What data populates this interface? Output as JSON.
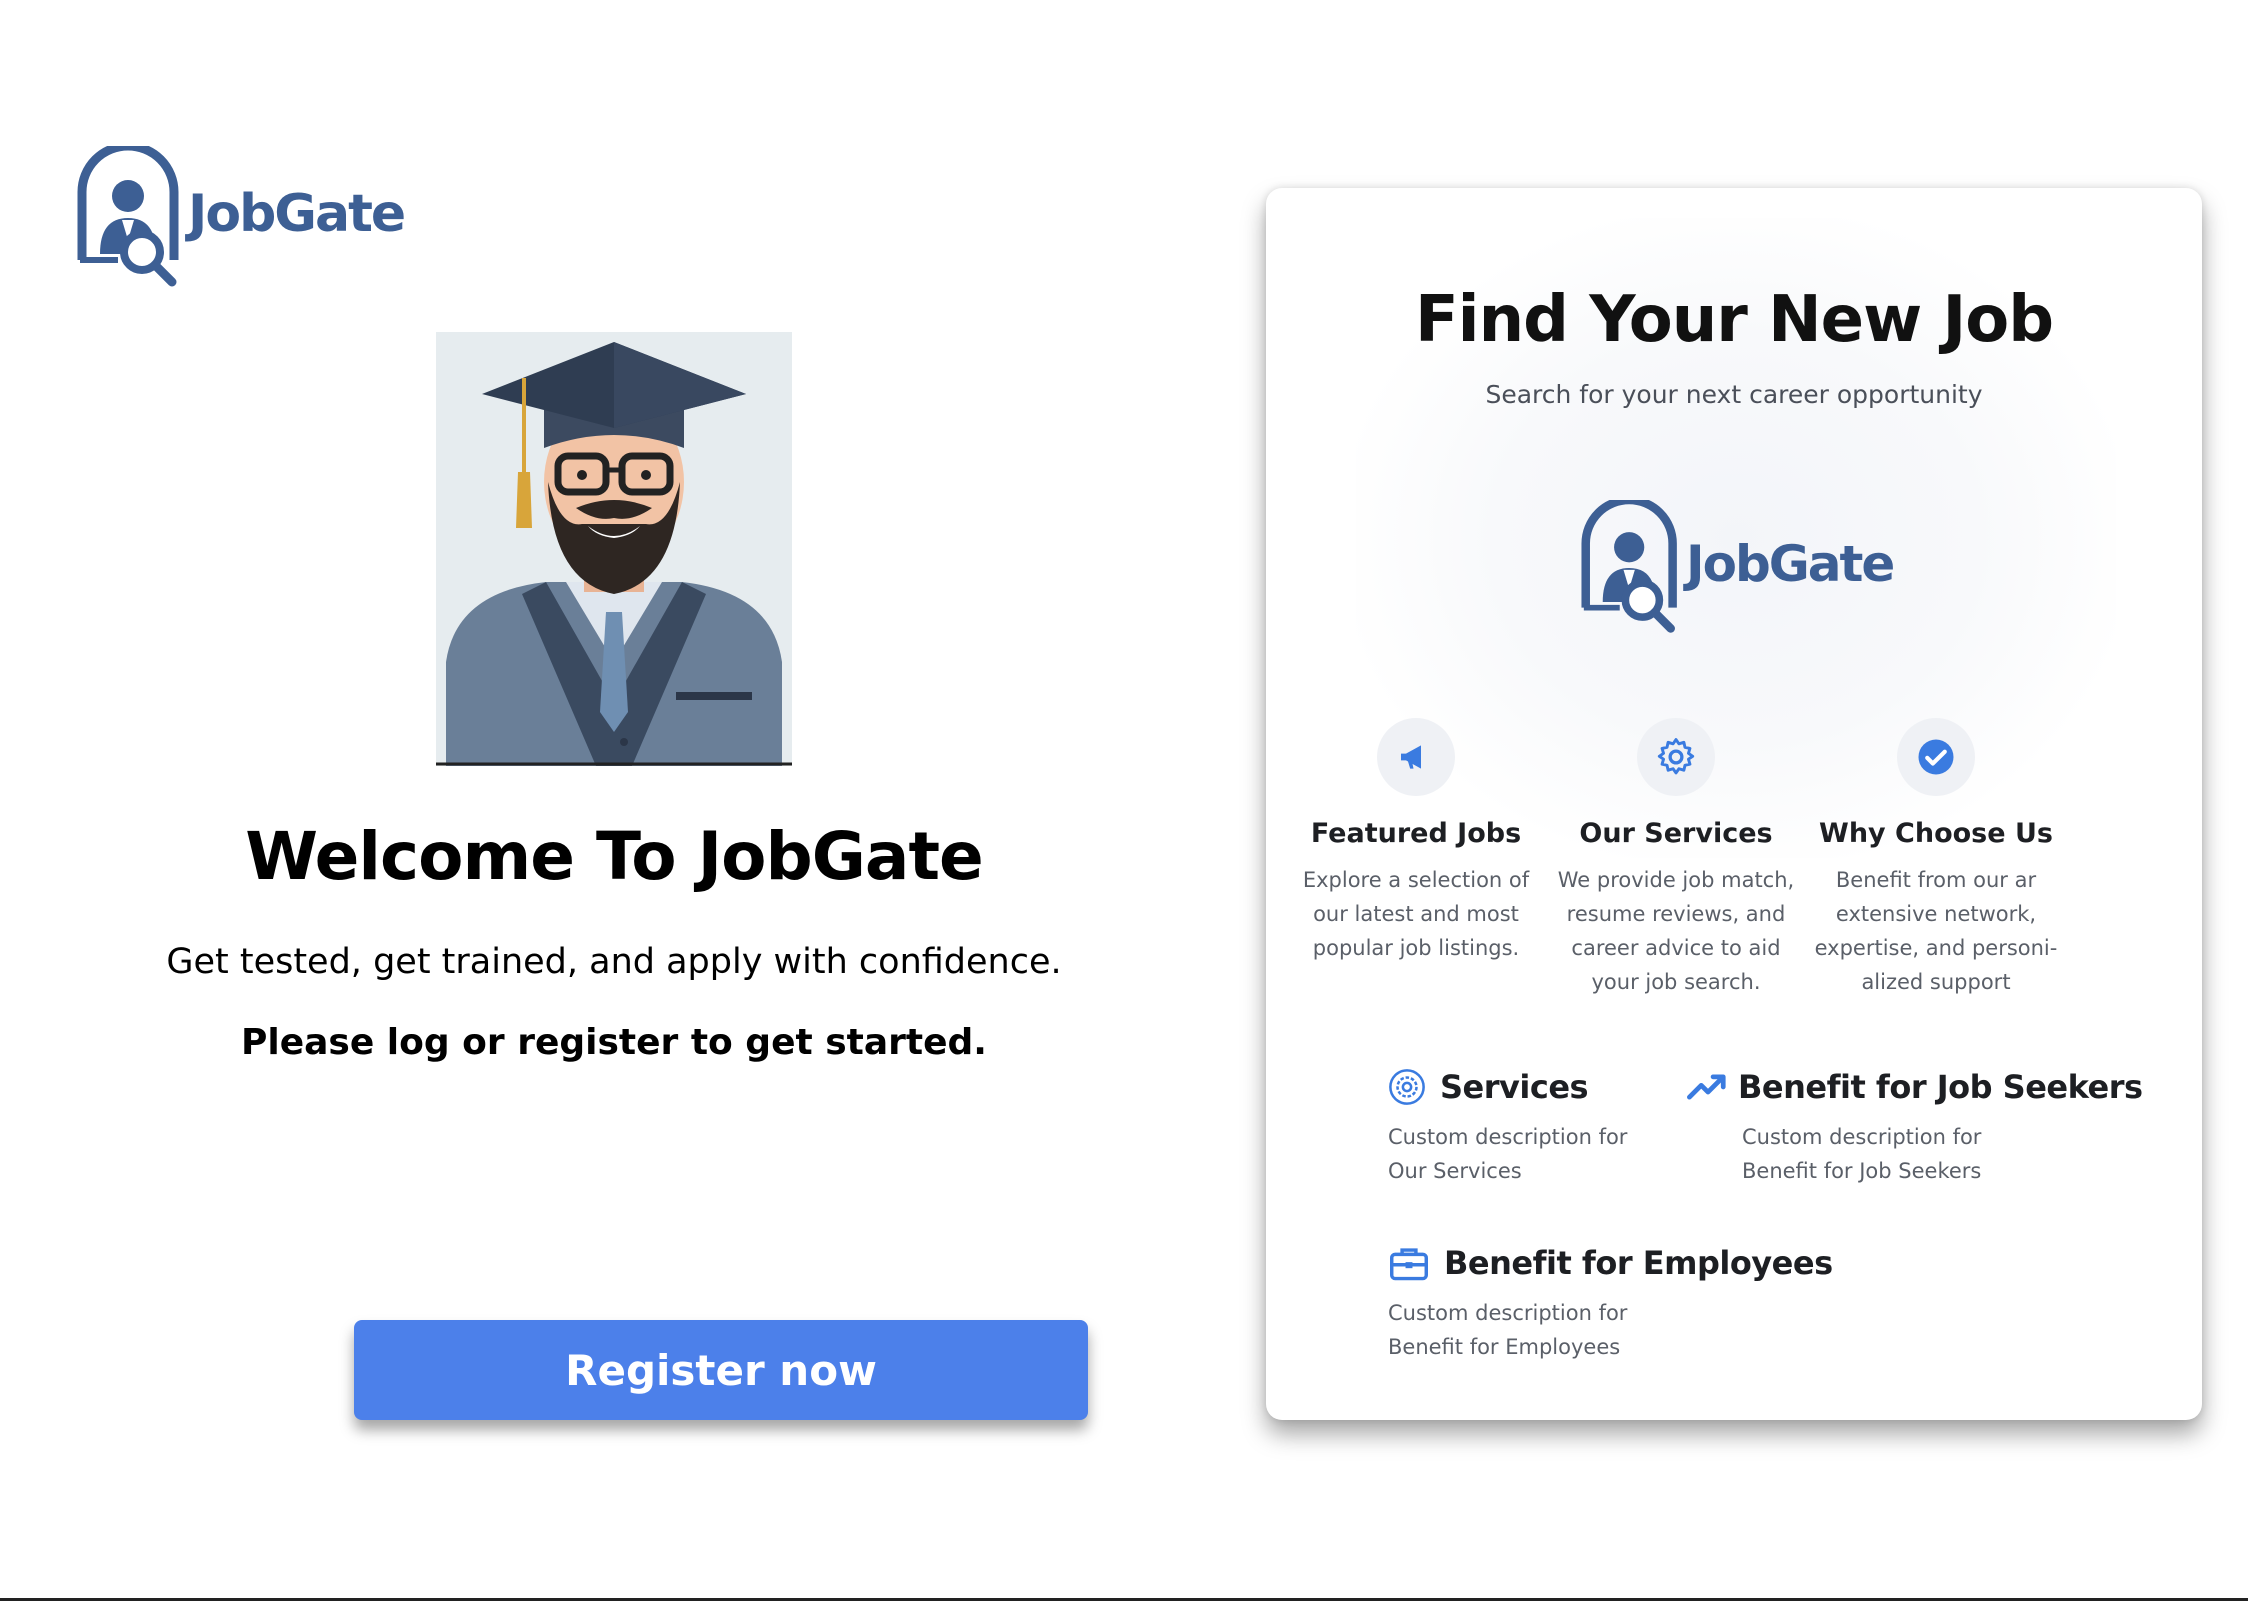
{
  "brand": {
    "name": "JobGate",
    "color": "#3d5f94"
  },
  "welcome": {
    "title": "Welcome To JobGate",
    "subtitle": "Get tested, get trained, and apply with confidence.",
    "cta_text": "Please log or register to get started."
  },
  "register_button": {
    "label": "Register now",
    "color": "#4c80ea"
  },
  "card": {
    "title": "Find Your New Job",
    "subtitle": "Search for your next career opportunity",
    "logo_text": "JobGate",
    "features": [
      {
        "icon": "megaphone-icon",
        "title": "Featured Jobs",
        "lines": [
          "Explore a selection of",
          "our latest and most",
          "popular job listings."
        ]
      },
      {
        "icon": "gear-icon",
        "title": "Our Services",
        "lines": [
          "We provide job match,",
          "resume reviews, and",
          "career advice to aid",
          "your job search."
        ]
      },
      {
        "icon": "check-circle-icon",
        "title": "Why Choose Us",
        "lines": [
          "Benefit from our ar",
          "extensive network,",
          "expertise, and personi-",
          "alized support"
        ]
      }
    ],
    "benefits": [
      {
        "icon": "gear-circle-icon",
        "title": "Services",
        "lines": [
          "Custom description for",
          "Our Services"
        ]
      },
      {
        "icon": "trending-up-icon",
        "title": "Benefit for Job Seekers",
        "lines": [
          "Custom description for",
          "Benefit for Job Seekers"
        ]
      },
      {
        "icon": "briefcase-icon",
        "title": "Benefit for Employees",
        "lines": [
          "Custom description for",
          "Benefit for Employees"
        ]
      }
    ]
  },
  "colors": {
    "accent": "#4c80ea",
    "icon_blue": "#3a7be0"
  }
}
